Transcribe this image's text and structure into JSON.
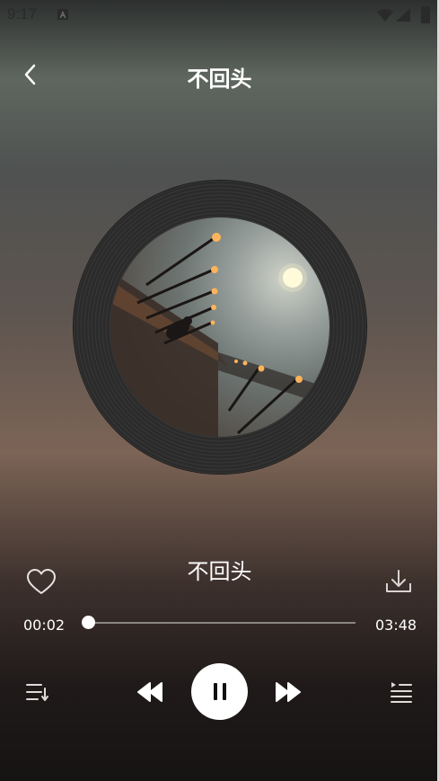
{
  "status_bar": {
    "time": "9:17"
  },
  "header": {
    "title": "不回头"
  },
  "player": {
    "song_name": "不回头",
    "current_time": "00:02",
    "total_time": "03:48",
    "progress_fraction": 0.01,
    "state": "playing"
  },
  "icons": {
    "back": "chevron-left-icon",
    "like": "heart-icon",
    "download": "download-icon",
    "play_order": "sort-list-icon",
    "previous": "rewind-icon",
    "pause": "pause-icon",
    "next": "fast-forward-icon",
    "playlist": "playlist-icon"
  },
  "colors": {
    "accent": "#ffffff",
    "track": "#8a8583"
  }
}
